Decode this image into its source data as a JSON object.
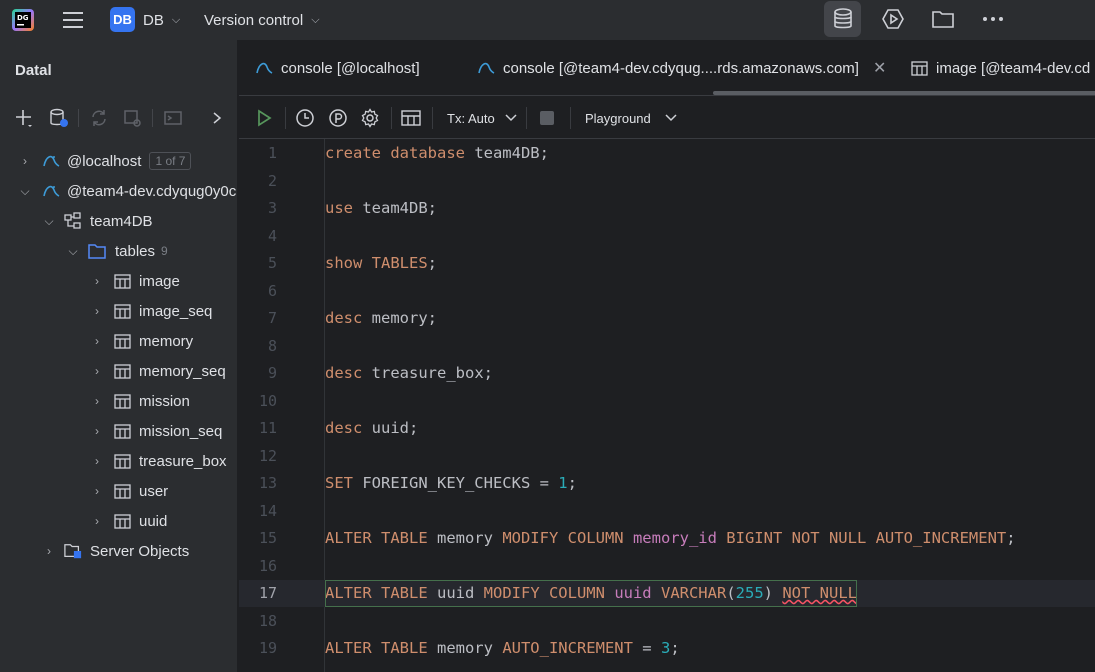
{
  "titlebar": {
    "project_badge": "DB",
    "project_name": "DB",
    "version_control": "Version control"
  },
  "database_panel": {
    "title": "Datal",
    "tree": {
      "localhost": {
        "label": "@localhost",
        "badge": "1 of 7"
      },
      "remote": {
        "label": "@team4-dev.cdyqug0y0c"
      },
      "schema": {
        "label": "team4DB"
      },
      "tables": {
        "label": "tables",
        "count": "9"
      },
      "table_items": [
        "image",
        "image_seq",
        "memory",
        "memory_seq",
        "mission",
        "mission_seq",
        "treasure_box",
        "user",
        "uuid"
      ],
      "server_objects": {
        "label": "Server Objects"
      }
    }
  },
  "tabs": [
    {
      "label": "console [@localhost]"
    },
    {
      "label": "console [@team4-dev.cdyqug....rds.amazonaws.com]",
      "active": true
    },
    {
      "label": "image [@team4-dev.cd"
    }
  ],
  "editor_toolbar": {
    "tx_mode": "Tx: Auto",
    "session": "Playground"
  },
  "editor": {
    "current_line": 17,
    "lines": [
      [
        {
          "t": "kw",
          "v": "create database "
        },
        {
          "t": "id",
          "v": "team4DB;"
        }
      ],
      [],
      [
        {
          "t": "kw",
          "v": "use "
        },
        {
          "t": "id",
          "v": "team4DB;"
        }
      ],
      [],
      [
        {
          "t": "kw",
          "v": "show TABLES"
        },
        {
          "t": "id",
          "v": ";"
        }
      ],
      [],
      [
        {
          "t": "kw",
          "v": "desc "
        },
        {
          "t": "id",
          "v": "memory;"
        }
      ],
      [],
      [
        {
          "t": "kw",
          "v": "desc "
        },
        {
          "t": "id",
          "v": "treasure_box;"
        }
      ],
      [],
      [
        {
          "t": "kw",
          "v": "desc "
        },
        {
          "t": "id",
          "v": "uuid;"
        }
      ],
      [],
      [
        {
          "t": "kw",
          "v": "SET "
        },
        {
          "t": "id",
          "v": "FOREIGN_KEY_CHECKS = "
        },
        {
          "t": "num",
          "v": "1"
        },
        {
          "t": "id",
          "v": ";"
        }
      ],
      [],
      [
        {
          "t": "kw",
          "v": "ALTER TABLE "
        },
        {
          "t": "id",
          "v": "memory "
        },
        {
          "t": "kw",
          "v": "MODIFY COLUMN "
        },
        {
          "t": "col",
          "v": "memory_id "
        },
        {
          "t": "kw",
          "v": "BIGINT NOT NULL AUTO_INCREMENT"
        },
        {
          "t": "id",
          "v": ";"
        }
      ],
      [],
      [
        {
          "t": "kw",
          "v": "ALTER TABLE "
        },
        {
          "t": "id",
          "v": "uuid "
        },
        {
          "t": "kw",
          "v": "MODIFY COLUMN "
        },
        {
          "t": "col",
          "v": "uuid "
        },
        {
          "t": "kw",
          "v": "VARCHAR"
        },
        {
          "t": "id",
          "v": "("
        },
        {
          "t": "num",
          "v": "255"
        },
        {
          "t": "id",
          "v": ") "
        },
        {
          "t": "kw",
          "v": "NOT NULL"
        }
      ],
      [],
      [
        {
          "t": "kw",
          "v": "ALTER TABLE "
        },
        {
          "t": "id",
          "v": "memory "
        },
        {
          "t": "kw",
          "v": "AUTO_INCREMENT "
        },
        {
          "t": "id",
          "v": "= "
        },
        {
          "t": "num",
          "v": "3"
        },
        {
          "t": "id",
          "v": ";"
        }
      ]
    ]
  }
}
